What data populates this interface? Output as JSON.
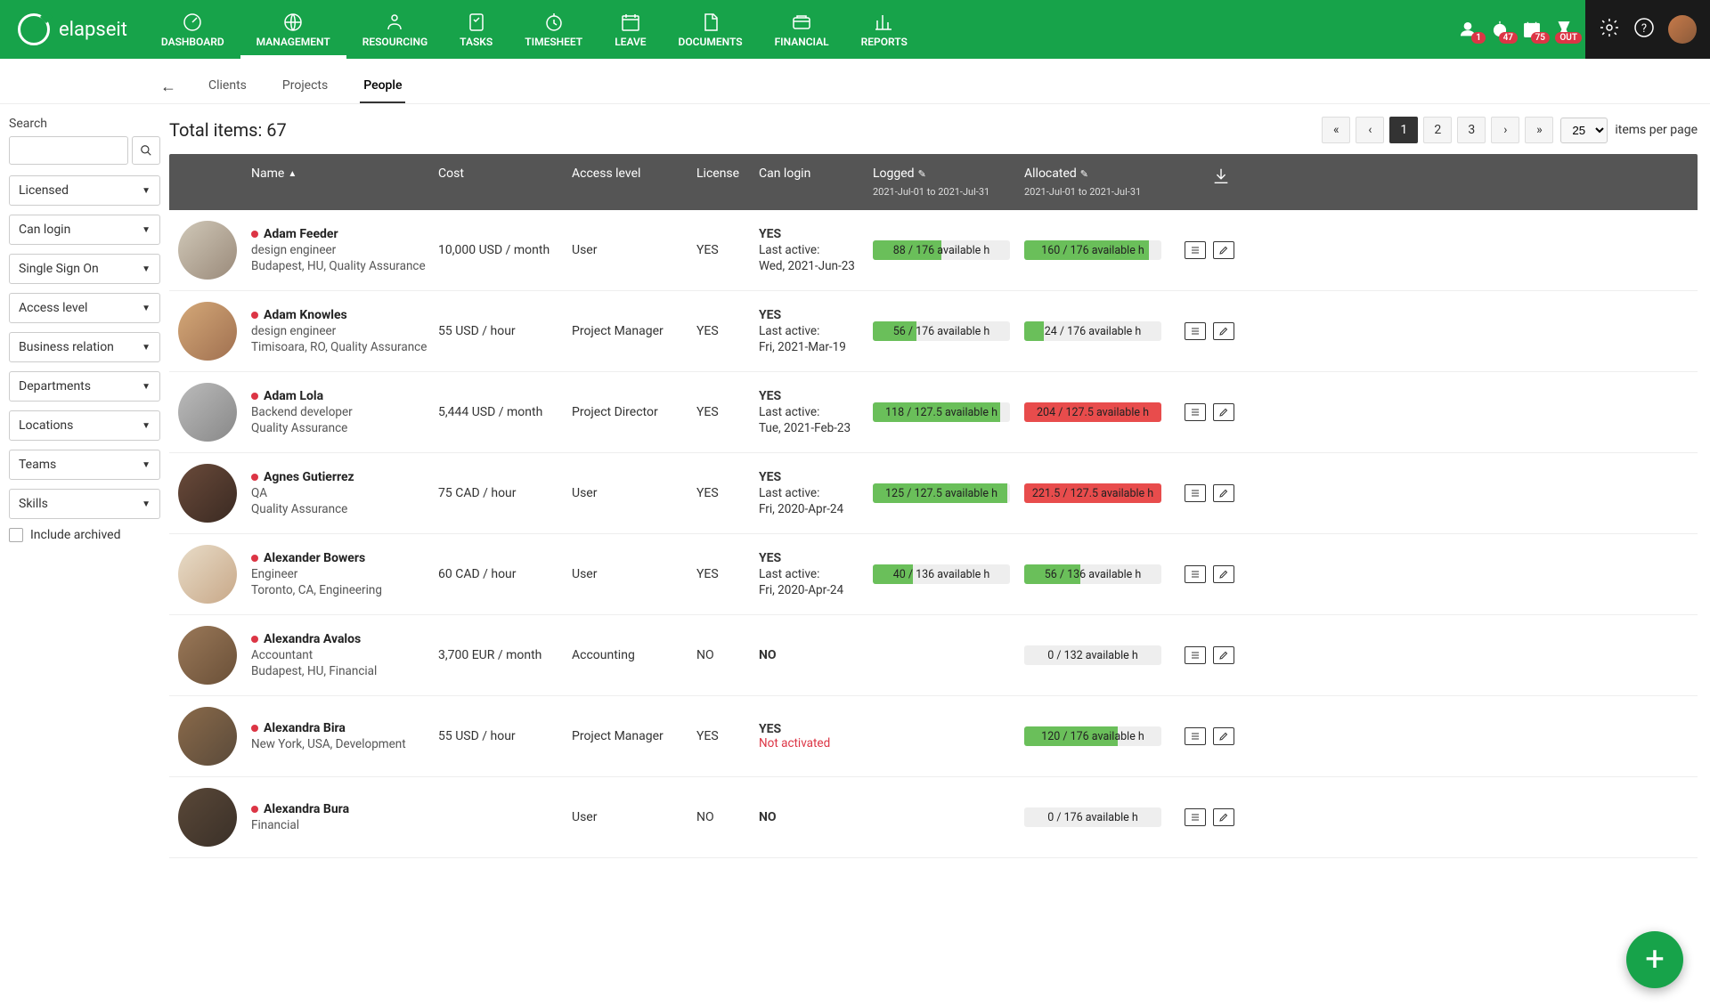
{
  "brand": "elapseit",
  "nav": [
    "DASHBOARD",
    "MANAGEMENT",
    "RESOURCING",
    "TASKS",
    "TIMESHEET",
    "LEAVE",
    "DOCUMENTS",
    "FINANCIAL",
    "REPORTS"
  ],
  "nav_active": "MANAGEMENT",
  "badges": {
    "b1": "1",
    "b2": "47",
    "b3": "75",
    "b4": "OUT"
  },
  "subtabs": [
    "Clients",
    "Projects",
    "People"
  ],
  "subtab_active": "People",
  "sidebar": {
    "search_label": "Search",
    "filters": [
      "Licensed",
      "Can login",
      "Single Sign On",
      "Access level",
      "Business relation",
      "Departments",
      "Locations",
      "Teams",
      "Skills"
    ],
    "include_archived": "Include archived"
  },
  "total_label": "Total items: 67",
  "items_per_page_label": "items per page",
  "per_page_value": "25",
  "pages": [
    "«",
    "‹",
    "1",
    "2",
    "3",
    "›",
    "»"
  ],
  "page_active": "1",
  "columns": {
    "name": "Name",
    "cost": "Cost",
    "access": "Access level",
    "license": "License",
    "canlogin": "Can login",
    "logged": "Logged",
    "allocated": "Allocated",
    "logged_range": "2021-Jul-01 to 2021-Jul-31",
    "allocated_range": "2021-Jul-01 to 2021-Jul-31"
  },
  "rows": [
    {
      "name": "Adam Feeder",
      "role": "design engineer",
      "loc": "Budapest, HU, Quality Assurance",
      "cost": "10,000 USD / month",
      "access": "User",
      "license": "YES",
      "login": "YES",
      "last_label": "Last active:",
      "last": "Wed, 2021-Jun-23",
      "logged": {
        "text": "88 / 176 available h",
        "pct": 50,
        "color": "green"
      },
      "allocated": {
        "text": "160 / 176 available h",
        "pct": 91,
        "color": "green"
      }
    },
    {
      "name": "Adam Knowles",
      "role": "design engineer",
      "loc": "Timisoara, RO, Quality Assurance",
      "cost": "55 USD / hour",
      "access": "Project Manager",
      "license": "YES",
      "login": "YES",
      "last_label": "Last active:",
      "last": "Fri, 2021-Mar-19",
      "logged": {
        "text": "56 / 176 available h",
        "pct": 32,
        "color": "green"
      },
      "allocated": {
        "text": "24 / 176 available h",
        "pct": 14,
        "color": "green"
      }
    },
    {
      "name": "Adam Lola",
      "role": "Backend developer",
      "loc": "Quality Assurance",
      "cost": "5,444 USD / month",
      "access": "Project Director",
      "license": "YES",
      "login": "YES",
      "last_label": "Last active:",
      "last": "Tue, 2021-Feb-23",
      "logged": {
        "text": "118 / 127.5 available h",
        "pct": 93,
        "color": "green"
      },
      "allocated": {
        "text": "204 / 127.5 available h",
        "pct": 100,
        "color": "red"
      }
    },
    {
      "name": "Agnes Gutierrez",
      "role": "QA",
      "loc": "Quality Assurance",
      "cost": "75 CAD / hour",
      "access": "User",
      "license": "YES",
      "login": "YES",
      "last_label": "Last active:",
      "last": "Fri, 2020-Apr-24",
      "logged": {
        "text": "125 / 127.5 available h",
        "pct": 98,
        "color": "green"
      },
      "allocated": {
        "text": "221.5 / 127.5 available h",
        "pct": 100,
        "color": "red"
      }
    },
    {
      "name": "Alexander Bowers",
      "role": "Engineer",
      "loc": "Toronto, CA, Engineering",
      "cost": "60 CAD / hour",
      "access": "User",
      "license": "YES",
      "login": "YES",
      "last_label": "Last active:",
      "last": "Fri, 2020-Apr-24",
      "logged": {
        "text": "40 / 136 available h",
        "pct": 29,
        "color": "green"
      },
      "allocated": {
        "text": "56 / 136 available h",
        "pct": 41,
        "color": "green"
      }
    },
    {
      "name": "Alexandra Avalos",
      "role": "Accountant",
      "loc": "Budapest, HU, Financial",
      "cost": "3,700 EUR / month",
      "access": "Accounting",
      "license": "NO",
      "login": "NO",
      "last_label": "",
      "last": "",
      "logged": null,
      "allocated": {
        "text": "0 / 132 available h",
        "pct": 0,
        "color": "grey"
      }
    },
    {
      "name": "Alexandra Bira",
      "role": "New York, USA, Development",
      "loc": "",
      "cost": "55 USD / hour",
      "access": "Project Manager",
      "license": "YES",
      "login": "YES",
      "last_label": "",
      "last": "",
      "not_activated": "Not activated",
      "logged": null,
      "allocated": {
        "text": "120 / 176 available h",
        "pct": 68,
        "color": "green"
      }
    },
    {
      "name": "Alexandra Bura",
      "role": "Financial",
      "loc": "",
      "cost": "",
      "access": "User",
      "license": "NO",
      "login": "NO",
      "last_label": "",
      "last": "",
      "logged": null,
      "allocated": {
        "text": "0 / 176 available h",
        "pct": 0,
        "color": "grey"
      }
    }
  ]
}
